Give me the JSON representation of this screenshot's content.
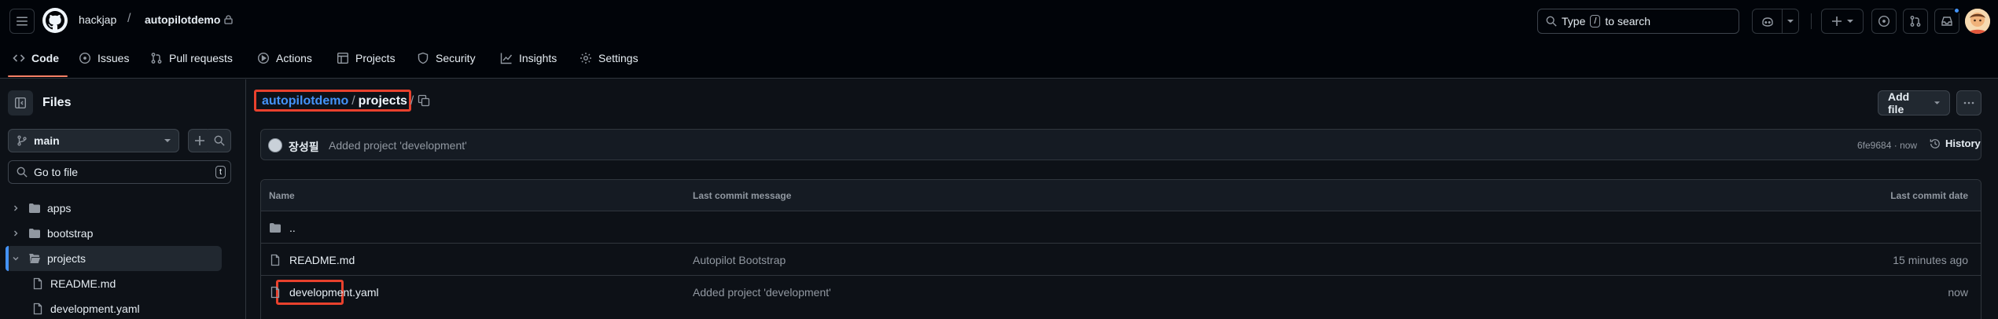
{
  "header": {
    "owner": "hackjap",
    "separator": "/",
    "repo": "autopilotdemo",
    "search": {
      "prefix": "Type",
      "key": "/",
      "suffix": "to search"
    }
  },
  "repo_nav": {
    "tabs": [
      {
        "label": "Code",
        "icon": "code-icon",
        "selected": true
      },
      {
        "label": "Issues",
        "icon": "issue-icon"
      },
      {
        "label": "Pull requests",
        "icon": "pull-request-icon"
      },
      {
        "label": "Actions",
        "icon": "play-icon"
      },
      {
        "label": "Projects",
        "icon": "table-icon"
      },
      {
        "label": "Security",
        "icon": "shield-icon"
      },
      {
        "label": "Insights",
        "icon": "graph-icon"
      },
      {
        "label": "Settings",
        "icon": "gear-icon"
      }
    ]
  },
  "sidebar": {
    "title": "Files",
    "branch": "main",
    "goto_placeholder": "Go to file",
    "goto_key": "t",
    "tree": [
      {
        "label": "apps",
        "type": "folder",
        "expanded": false
      },
      {
        "label": "bootstrap",
        "type": "folder",
        "expanded": false
      },
      {
        "label": "projects",
        "type": "folder",
        "expanded": true,
        "active": true
      },
      {
        "label": "README.md",
        "type": "file"
      },
      {
        "label": "development.yaml",
        "type": "file"
      }
    ]
  },
  "main": {
    "breadcrumb": {
      "repo_link": "autopilotdemo",
      "separator": "/",
      "current": "projects",
      "trailing": "/"
    },
    "add_file_label": "Add file",
    "commit": {
      "author": "장성필",
      "message": "Added project 'development'",
      "sha": "6fe9684",
      "dot": "·",
      "time": "now",
      "history_label": "History"
    },
    "table": {
      "headers": {
        "name": "Name",
        "message": "Last commit message",
        "date": "Last commit date"
      },
      "rows": [
        {
          "name": "..",
          "type": "folder",
          "message": "",
          "date": ""
        },
        {
          "name": "README.md",
          "type": "file",
          "message": "Autopilot Bootstrap",
          "date": "15 minutes ago"
        },
        {
          "name": "development.yaml",
          "type": "file",
          "message": "Added project 'development'",
          "date": "now"
        }
      ]
    }
  },
  "colors": {
    "accent": "#4493f8",
    "highlight_box": "#e8412d",
    "tab_underline": "#f78166"
  }
}
